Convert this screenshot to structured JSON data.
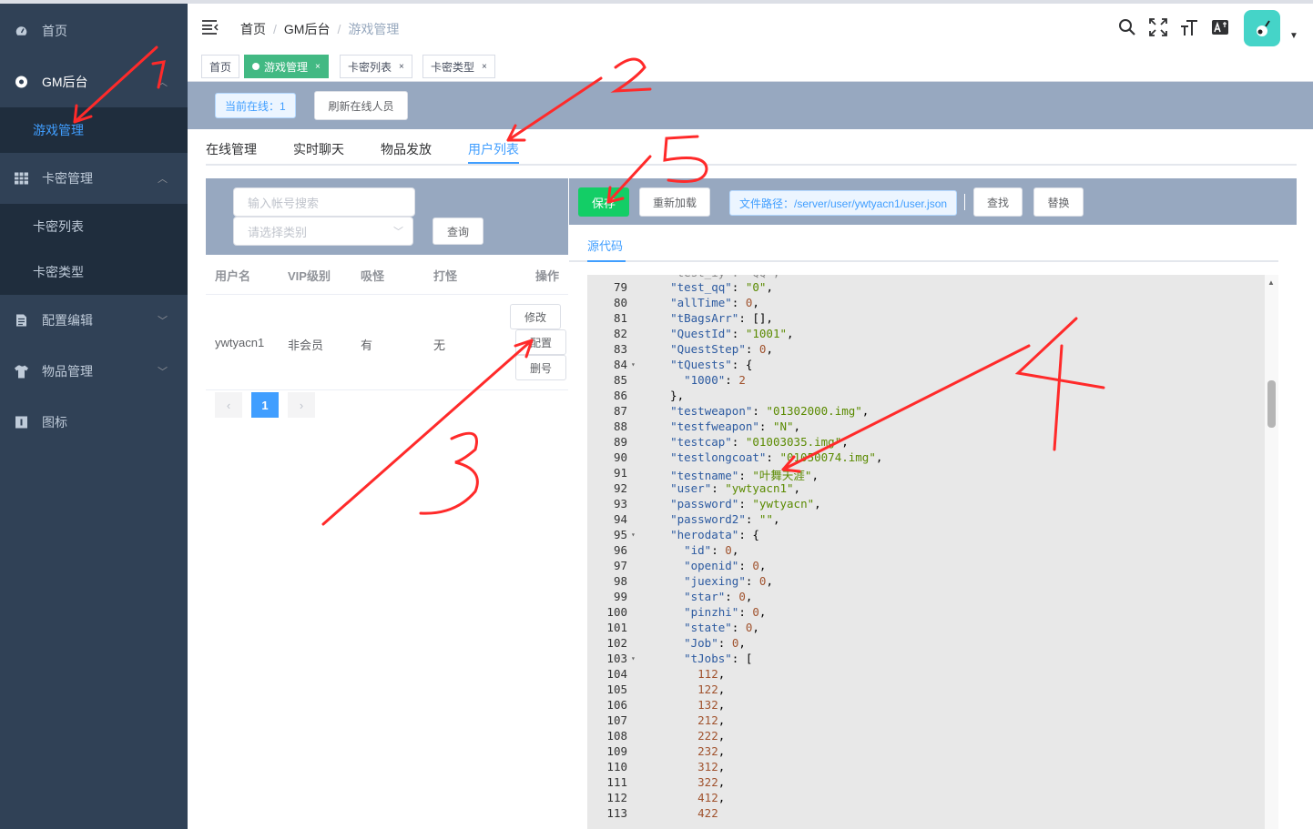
{
  "sidebar": {
    "items": [
      {
        "label": "首页",
        "icon": "dashboard-icon"
      },
      {
        "label": "GM后台",
        "icon": "gm-icon"
      },
      {
        "label": "卡密管理",
        "icon": "table-icon"
      },
      {
        "label": "配置编辑",
        "icon": "document-icon"
      },
      {
        "label": "物品管理",
        "icon": "shirt-icon"
      },
      {
        "label": "图标",
        "icon": "info-icon"
      }
    ],
    "gm_sub": [
      "游戏管理"
    ],
    "card_sub": [
      "卡密列表",
      "卡密类型"
    ]
  },
  "header": {
    "breadcrumb": [
      "首页",
      "GM后台",
      "游戏管理"
    ]
  },
  "tags": [
    {
      "label": "首页"
    },
    {
      "label": "游戏管理",
      "close": "×"
    },
    {
      "label": "卡密列表",
      "close": "×"
    },
    {
      "label": "卡密类型",
      "close": "×"
    }
  ],
  "online": {
    "label": "当前在线：1",
    "refresh": "刷新在线人员"
  },
  "tabs": [
    "在线管理",
    "实时聊天",
    "物品发放",
    "用户列表"
  ],
  "filter": {
    "account_placeholder": "输入帐号搜索",
    "category_placeholder": "请选择类别",
    "query": "查询"
  },
  "table": {
    "headers": [
      "用户名",
      "VIP级别",
      "吸怪",
      "打怪",
      "操作"
    ],
    "rows": [
      {
        "user": "ywtyacn1",
        "vip": "非会员",
        "absorb": "有",
        "fight": "无"
      }
    ],
    "actions": [
      "修改",
      "配置",
      "删号"
    ]
  },
  "pagination": {
    "prev": "‹",
    "current": "1",
    "next": "›"
  },
  "editor_toolbar": {
    "save": "保存",
    "reload": "重新加载",
    "path": "文件路径：/server/user/ywtyacn1/user.json",
    "find": "查找",
    "replace": "替换"
  },
  "source_tab": "源代码",
  "code_lines": [
    {
      "n": "79",
      "fold": false,
      "html": "  <span class=\"k\">\"test_qq\"</span>: <span class=\"s\">\"0\"</span>,"
    },
    {
      "n": "80",
      "fold": false,
      "html": "  <span class=\"k\">\"allTime\"</span>: <span class=\"n\">0</span>,"
    },
    {
      "n": "81",
      "fold": false,
      "html": "  <span class=\"k\">\"tBagsArr\"</span>: [],"
    },
    {
      "n": "82",
      "fold": false,
      "html": "  <span class=\"k\">\"QuestId\"</span>: <span class=\"s\">\"1001\"</span>,"
    },
    {
      "n": "83",
      "fold": false,
      "html": "  <span class=\"k\">\"QuestStep\"</span>: <span class=\"n\">0</span>,"
    },
    {
      "n": "84",
      "fold": true,
      "html": "  <span class=\"k\">\"tQuests\"</span>: {"
    },
    {
      "n": "85",
      "fold": false,
      "html": "    <span class=\"k\">\"1000\"</span>: <span class=\"n\">2</span>"
    },
    {
      "n": "86",
      "fold": false,
      "html": "  },"
    },
    {
      "n": "87",
      "fold": false,
      "html": "  <span class=\"k\">\"testweapon\"</span>: <span class=\"s\">\"01302000.img\"</span>,"
    },
    {
      "n": "88",
      "fold": false,
      "html": "  <span class=\"k\">\"testfweapon\"</span>: <span class=\"s\">\"N\"</span>,"
    },
    {
      "n": "89",
      "fold": false,
      "html": "  <span class=\"k\">\"testcap\"</span>: <span class=\"s\">\"01003035.img\"</span>,"
    },
    {
      "n": "90",
      "fold": false,
      "html": "  <span class=\"k\">\"testlongcoat\"</span>: <span class=\"s\">\"01050074.img\"</span>,"
    },
    {
      "n": "91",
      "fold": false,
      "html": "  <span class=\"k\">\"testname\"</span>: <span class=\"s\">\"叶舞天涯\"</span>,"
    },
    {
      "n": "92",
      "fold": false,
      "html": "  <span class=\"k\">\"user\"</span>: <span class=\"s\">\"ywtyacn1\"</span>,"
    },
    {
      "n": "93",
      "fold": false,
      "html": "  <span class=\"k\">\"password\"</span>: <span class=\"s\">\"ywtyacn\"</span>,"
    },
    {
      "n": "94",
      "fold": false,
      "html": "  <span class=\"k\">\"password2\"</span>: <span class=\"s\">\"\"</span>,"
    },
    {
      "n": "95",
      "fold": true,
      "html": "  <span class=\"k\">\"herodata\"</span>: {"
    },
    {
      "n": "96",
      "fold": false,
      "html": "    <span class=\"k\">\"id\"</span>: <span class=\"n\">0</span>,"
    },
    {
      "n": "97",
      "fold": false,
      "html": "    <span class=\"k\">\"openid\"</span>: <span class=\"n\">0</span>,"
    },
    {
      "n": "98",
      "fold": false,
      "html": "    <span class=\"k\">\"juexing\"</span>: <span class=\"n\">0</span>,"
    },
    {
      "n": "99",
      "fold": false,
      "html": "    <span class=\"k\">\"star\"</span>: <span class=\"n\">0</span>,"
    },
    {
      "n": "100",
      "fold": false,
      "html": "    <span class=\"k\">\"pinzhi\"</span>: <span class=\"n\">0</span>,"
    },
    {
      "n": "101",
      "fold": false,
      "html": "    <span class=\"k\">\"state\"</span>: <span class=\"n\">0</span>,"
    },
    {
      "n": "102",
      "fold": false,
      "html": "    <span class=\"k\">\"Job\"</span>: <span class=\"n\">0</span>,"
    },
    {
      "n": "103",
      "fold": true,
      "html": "    <span class=\"k\">\"tJobs\"</span>: ["
    },
    {
      "n": "104",
      "fold": false,
      "html": "      <span class=\"n\">112</span>,"
    },
    {
      "n": "105",
      "fold": false,
      "html": "      <span class=\"n\">122</span>,"
    },
    {
      "n": "106",
      "fold": false,
      "html": "      <span class=\"n\">132</span>,"
    },
    {
      "n": "107",
      "fold": false,
      "html": "      <span class=\"n\">212</span>,"
    },
    {
      "n": "108",
      "fold": false,
      "html": "      <span class=\"n\">222</span>,"
    },
    {
      "n": "109",
      "fold": false,
      "html": "      <span class=\"n\">232</span>,"
    },
    {
      "n": "110",
      "fold": false,
      "html": "      <span class=\"n\">312</span>,"
    },
    {
      "n": "111",
      "fold": false,
      "html": "      <span class=\"n\">322</span>,"
    },
    {
      "n": "112",
      "fold": false,
      "html": "      <span class=\"n\">412</span>,"
    },
    {
      "n": "113",
      "fold": false,
      "html": "      <span class=\"n\">422</span>"
    }
  ],
  "annotations": [
    "1",
    "2",
    "3",
    "4",
    "5"
  ],
  "colors": {
    "sidebar": "#304156",
    "accent": "#409eff",
    "save": "#13ce66",
    "tag_active": "#42b983",
    "arrow": "#ff2a2a"
  }
}
